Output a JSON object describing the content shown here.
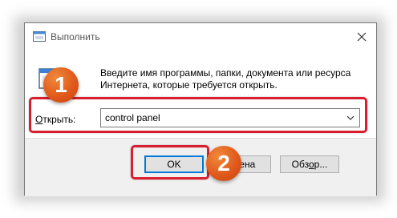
{
  "window": {
    "title": "Выполнить",
    "close_icon": "close-icon"
  },
  "description": "Введите имя программы, папки, документа или ресурса Интернета, которые требуется открыть.",
  "open_field": {
    "label_underlined": "О",
    "label_rest": "ткрыть:",
    "value": "control panel"
  },
  "buttons": {
    "ok": "OK",
    "cancel": "Отмена",
    "cancel_visible": "ена",
    "browse_before": "Обз",
    "browse_underlined": "о",
    "browse_after": "р..."
  },
  "badges": {
    "first": "1",
    "second": "2"
  },
  "colors": {
    "highlight": "#d91f2f",
    "badge": "#e05a1c",
    "ok_focus": "#0078d7"
  }
}
